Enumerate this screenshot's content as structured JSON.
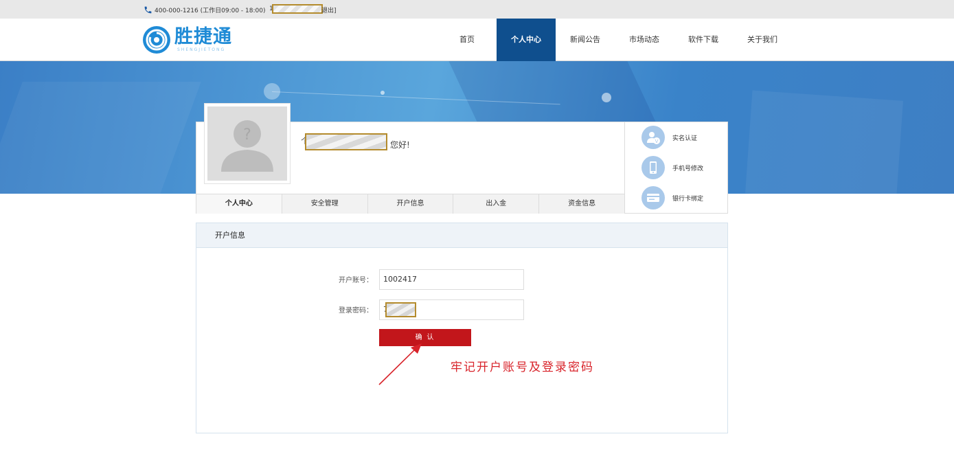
{
  "topbar": {
    "phone_text": "400-000-1216 (工作日09:00 - 18:00)",
    "logout_lead": "1",
    "logout_label": "退出]",
    "logout_suffix": "]"
  },
  "header": {
    "logo_cn": "胜捷通",
    "logo_en": "SHENGJIETONG",
    "nav": [
      {
        "label": "首页"
      },
      {
        "label": "个人中心"
      },
      {
        "label": "新闻公告"
      },
      {
        "label": "市场动态"
      },
      {
        "label": "软件下载"
      },
      {
        "label": "关于我们"
      }
    ]
  },
  "profile": {
    "greeting_lead": "个",
    "greeting": "您好!",
    "tabs": [
      {
        "label": "个人中心"
      },
      {
        "label": "安全管理"
      },
      {
        "label": "开户信息"
      },
      {
        "label": "出入金"
      },
      {
        "label": "资金信息"
      }
    ],
    "side_links": [
      {
        "label": "实名认证",
        "icon": "user-verify-icon"
      },
      {
        "label": "手机号修改",
        "icon": "phone-icon"
      },
      {
        "label": "银行卡绑定",
        "icon": "bank-card-icon"
      }
    ]
  },
  "account_panel": {
    "title": "开户信息",
    "account_label": "开户账号：",
    "account_value": "1002417",
    "password_label": "登录密码：",
    "password_value": "7",
    "confirm_label": "确 认",
    "annotation": "牢记开户账号及登录密码"
  },
  "colors": {
    "nav_active": "#0f4f8e",
    "confirm_button": "#c2161b",
    "annotation": "#d8232a",
    "logo": "#1f8bd6"
  }
}
